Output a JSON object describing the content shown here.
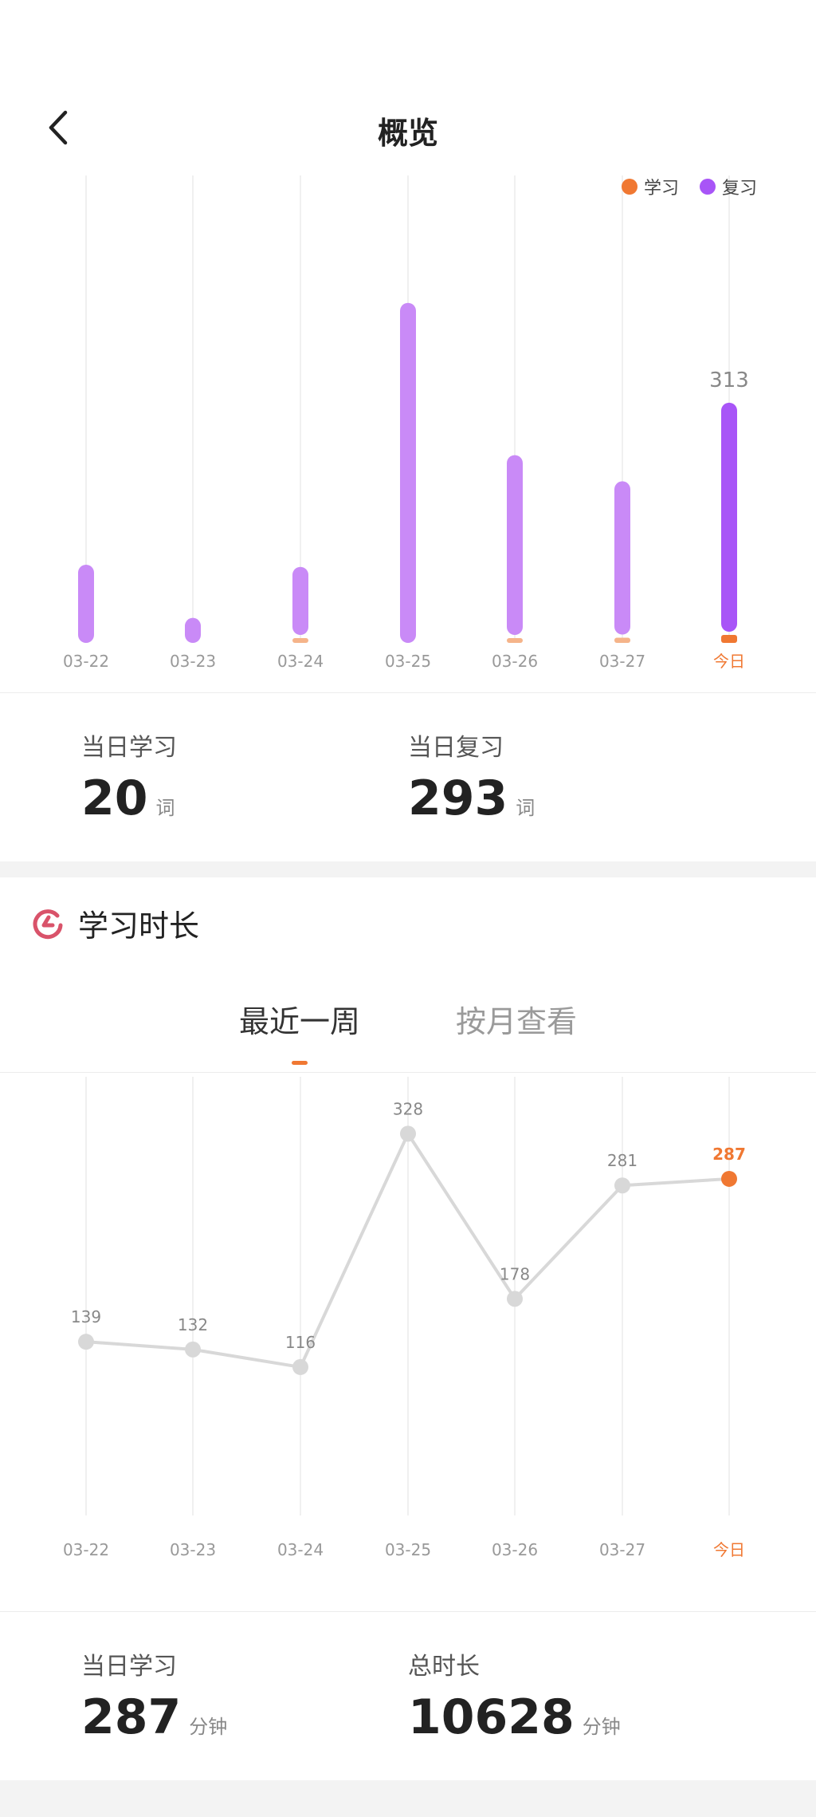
{
  "header": {
    "title": "概览"
  },
  "legend": [
    {
      "label": "学习",
      "color": "#f07832"
    },
    {
      "label": "复习",
      "color": "#a855f7"
    }
  ],
  "review_chart": {
    "chart_data": {
      "type": "bar",
      "categories": [
        "03-22",
        "03-23",
        "03-24",
        "03-25",
        "03-26",
        "03-27",
        "今日"
      ],
      "series": [
        {
          "name": "学习",
          "color": "#f07832",
          "values": [
            0,
            0,
            5,
            0,
            6,
            13,
            20
          ]
        },
        {
          "name": "复习",
          "color": "#a855f7",
          "values": [
            100,
            32,
            87,
            435,
            230,
            196,
            293
          ]
        }
      ],
      "labels": {
        "6": "313"
      },
      "highlight_index": 6,
      "highlight_color": "#f07832"
    }
  },
  "review_stats": {
    "study_label": "当日学习",
    "study_value": "20",
    "study_unit": "词",
    "review_label": "当日复习",
    "review_value": "293",
    "review_unit": "词"
  },
  "duration": {
    "title": "学习时长",
    "tabs": [
      {
        "label": "最近一周",
        "active": true
      },
      {
        "label": "按月查看",
        "active": false
      }
    ],
    "chart_data": {
      "type": "line",
      "categories": [
        "03-22",
        "03-23",
        "03-24",
        "03-25",
        "03-26",
        "03-27",
        "今日"
      ],
      "values": [
        139,
        132,
        116,
        328,
        178,
        281,
        287
      ],
      "highlight_index": 6,
      "line_color": "#d8d8d8",
      "highlight_color": "#f07832",
      "ylim": [
        0,
        350
      ]
    },
    "stats": {
      "today_label": "当日学习",
      "today_value": "287",
      "today_unit": "分钟",
      "total_label": "总时长",
      "total_value": "10628",
      "total_unit": "分钟"
    }
  }
}
